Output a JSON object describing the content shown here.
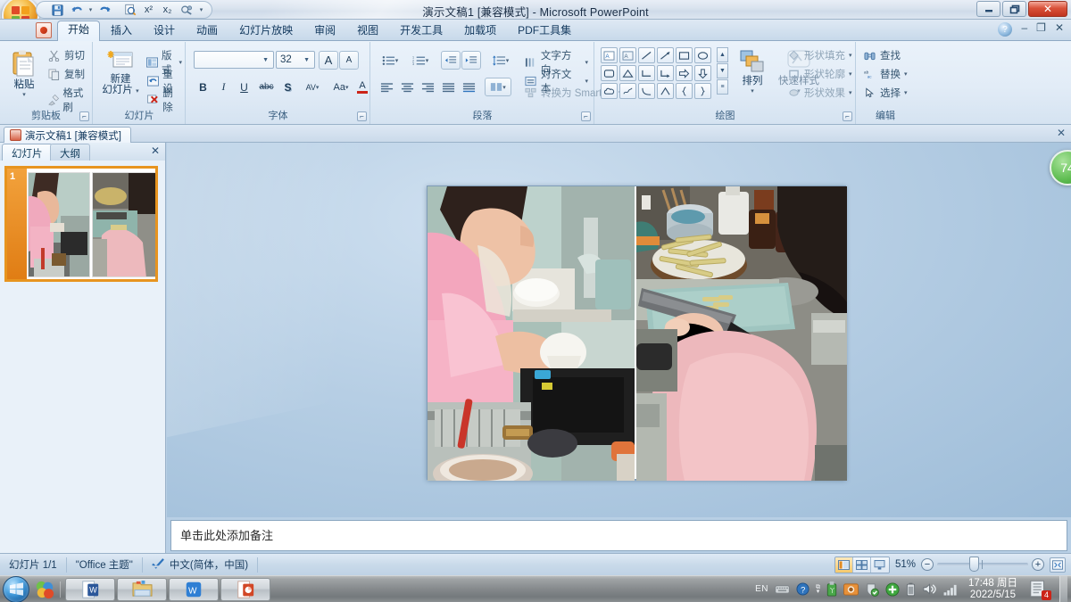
{
  "titlebar": {
    "document_title": "演示文稿1 [兼容模式] - Microsoft PowerPoint",
    "office_button": "office-button",
    "qat": [
      {
        "name": "save-button",
        "glyph": "💾"
      },
      {
        "name": "undo-button",
        "glyph": "↶"
      },
      {
        "name": "undo-dropdown",
        "glyph": "▾"
      },
      {
        "name": "redo-button",
        "glyph": "↻"
      },
      {
        "name": "print-preview-button",
        "glyph": "🔍"
      },
      {
        "name": "superscript-button",
        "glyph": "x²"
      },
      {
        "name": "subscript-button",
        "glyph": "x₂"
      },
      {
        "name": "custom-button",
        "glyph": "⚗"
      },
      {
        "name": "qat-customize-button",
        "glyph": "▾"
      }
    ],
    "window_controls": {
      "minimize": "–",
      "restore": "❐",
      "close": "✕"
    }
  },
  "ribbon": {
    "tabs": [
      {
        "label": "开始",
        "active": true
      },
      {
        "label": "插入",
        "active": false
      },
      {
        "label": "设计",
        "active": false
      },
      {
        "label": "动画",
        "active": false
      },
      {
        "label": "幻灯片放映",
        "active": false
      },
      {
        "label": "审阅",
        "active": false
      },
      {
        "label": "视图",
        "active": false
      },
      {
        "label": "开发工具",
        "active": false
      },
      {
        "label": "加载项",
        "active": false
      },
      {
        "label": "PDF工具集",
        "active": false
      }
    ],
    "help_button": "?",
    "window_mini": {
      "minimize": "–",
      "restore": "❐",
      "close": "✕"
    },
    "groups": {
      "clipboard": {
        "title": "剪贴板",
        "paste": "粘贴",
        "paste_caret": "▾",
        "cut": "剪切",
        "copy": "复制",
        "format_painter": "格式刷"
      },
      "slides": {
        "title": "幻灯片",
        "new_slide_line1": "新建",
        "new_slide_line2": "幻灯片",
        "new_slide_caret": "▾",
        "layout": "版式",
        "reset": "重设",
        "delete": "删除",
        "caret": "▾"
      },
      "font": {
        "title": "字体",
        "font_name_value": "",
        "font_size_value": "32",
        "grow_font": "A",
        "shrink_font": "A",
        "clear_formatting": "✐",
        "bold": "B",
        "italic": "I",
        "underline": "U",
        "strikethrough": "abc",
        "shadow": "S",
        "char_spacing": "AV",
        "change_case": "Aa",
        "font_color": "A",
        "caret": "▾"
      },
      "paragraph": {
        "title": "段落",
        "text_direction": "文字方向",
        "align_text": "对齐文本",
        "convert_smartart": "转换为 SmartArt",
        "caret": "▾"
      },
      "drawing": {
        "title": "绘图",
        "arrange_line1": "排列",
        "quick_styles_line1": "快速样式",
        "shape_fill": "形状填充",
        "shape_outline": "形状轮廓",
        "shape_effects": "形状效果",
        "caret": "▾",
        "scroll_up": "▲",
        "scroll_down": "▼",
        "scroll_more": "≡"
      },
      "editing": {
        "title": "编辑",
        "find": "查找",
        "replace": "替换",
        "select": "选择",
        "caret": "▾"
      }
    }
  },
  "doctab": {
    "label": "演示文稿1 [兼容模式]",
    "close": "✕"
  },
  "left_pane": {
    "tabs": [
      {
        "label": "幻灯片",
        "active": true
      },
      {
        "label": "大纲",
        "active": false
      }
    ],
    "close": "✕",
    "slides": [
      {
        "number": "1",
        "selected": true
      }
    ]
  },
  "slide": {
    "images": [
      {
        "name": "photo-washing-dishes",
        "alt": "女孩在厨房水槽边洗碗"
      },
      {
        "name": "photo-cutting-vegetables",
        "alt": "女孩在案板上切菜"
      }
    ]
  },
  "overlay": {
    "green_badge_value": "74"
  },
  "notes": {
    "placeholder": "单击此处添加备注"
  },
  "statusbar": {
    "slide_count": "幻灯片 1/1",
    "theme": "\"Office 主题\"",
    "language": "中文(简体，中国)",
    "spellcheck_icon": "spellcheck-icon",
    "view_buttons": [
      {
        "name": "normal-view-button",
        "active": true
      },
      {
        "name": "slide-sorter-view-button",
        "active": false
      },
      {
        "name": "slideshow-view-button",
        "active": false
      }
    ],
    "zoom_level": "51%",
    "zoom_out": "−",
    "zoom_in": "+",
    "fit_window": "fit-slide-to-window-icon"
  },
  "taskbar": {
    "start": "start-orb",
    "quicklaunch": [
      {
        "name": "quicklaunch-media-icon"
      }
    ],
    "tasks": [
      {
        "name": "taskbar-word-button",
        "glyph": "W"
      },
      {
        "name": "taskbar-explorer-button",
        "glyph": "📁"
      },
      {
        "name": "taskbar-wps-button",
        "glyph": "W"
      },
      {
        "name": "taskbar-powerpoint-button",
        "glyph": "P"
      }
    ],
    "tray": [
      {
        "name": "input-language-indicator",
        "label": "EN"
      },
      {
        "name": "keyboard-icon",
        "label": ""
      },
      {
        "name": "help-icon",
        "label": "?"
      },
      {
        "name": "tray-expand-icon",
        "label": "▾"
      },
      {
        "name": "usb-drive-icon",
        "label": ""
      },
      {
        "name": "camera-icon",
        "label": ""
      },
      {
        "name": "security-shield-icon",
        "label": ""
      },
      {
        "name": "update-icon",
        "label": "+"
      },
      {
        "name": "battery-icon",
        "label": ""
      },
      {
        "name": "volume-icon",
        "label": ""
      },
      {
        "name": "network-signal-icon",
        "label": ""
      }
    ],
    "clock": {
      "time": "17:48 周日",
      "date": "2022/5/15"
    },
    "notifications": {
      "icon": "notification-center-icon",
      "count": "4"
    }
  },
  "colors": {
    "accent_blue": "#2e6ca4",
    "ribbon_bg": "#e2ecf7",
    "desktop_blue": "#b8cfe5",
    "selection_orange": "#e7941f",
    "close_red": "#c0341f",
    "badge_green": "#5fbd52"
  }
}
